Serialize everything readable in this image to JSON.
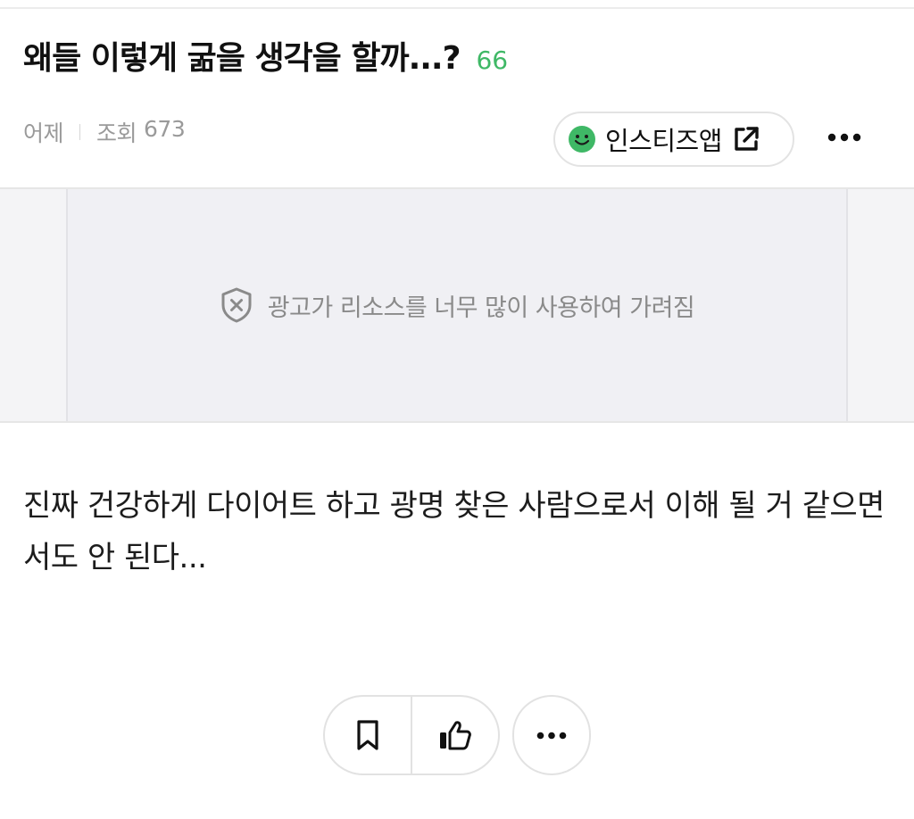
{
  "post": {
    "title": "왜들 이렇게 굶을 생각을 할까...?",
    "comment_count": "66",
    "date": "어제",
    "views_label": "조회",
    "views_count": "673"
  },
  "app_button": {
    "label": "인스티즈앱",
    "icon": "smile-icon",
    "accent_color": "#3fb866"
  },
  "ad": {
    "message": "광고가 리소스를 너무 많이 사용하여 가려짐",
    "icon": "shield-x-icon"
  },
  "content": {
    "body": "진짜 건강하게 다이어트 하고 광명 찾은 사람으로서 이해 될 거 같으면서도 안 된다..."
  },
  "actions": {
    "bookmark_icon": "bookmark-icon",
    "like_icon": "thumbs-up-icon",
    "more_icon": "more-icon"
  }
}
